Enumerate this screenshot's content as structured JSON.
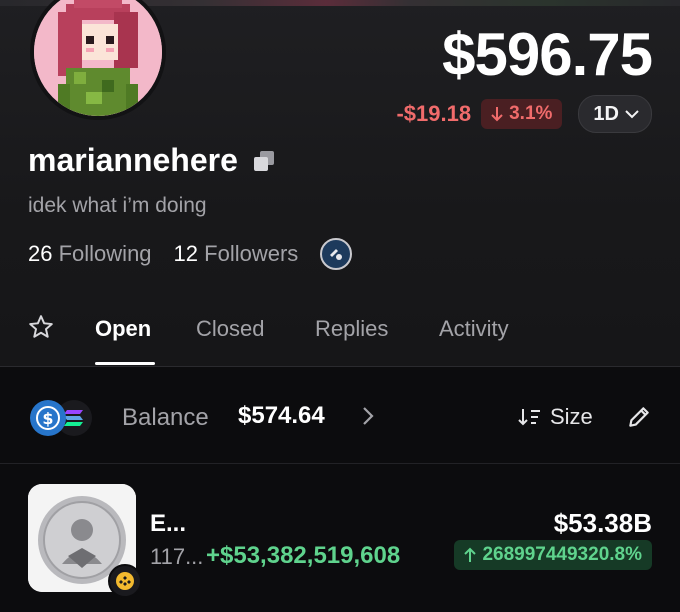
{
  "profile": {
    "username": "mariannehere",
    "bio": "idek what i’m doing",
    "following_count": "26",
    "following_label": "Following",
    "followers_count": "12",
    "followers_label": "Followers"
  },
  "portfolio": {
    "value": "$596.75",
    "change_abs": "-$19.18",
    "change_pct": "3.1%",
    "change_direction": "down",
    "timeframe": "1D",
    "down_color": "#f06b6b",
    "up_color": "#5fd38d"
  },
  "tabs": [
    {
      "label": "Open",
      "active": true
    },
    {
      "label": "Closed",
      "active": false
    },
    {
      "label": "Replies",
      "active": false
    },
    {
      "label": "Activity",
      "active": false
    }
  ],
  "balance": {
    "label": "Balance",
    "value": "$574.64",
    "sort_label": "Size",
    "coins": [
      "usdc-icon",
      "solana-icon"
    ]
  },
  "positions": [
    {
      "name": "E...",
      "quantity": "117...",
      "pnl": "+$53,382,519,608",
      "pnl_pct": "268997449320.8%",
      "value": "$53.38B",
      "chain": "bnb-chain-icon"
    }
  ]
}
